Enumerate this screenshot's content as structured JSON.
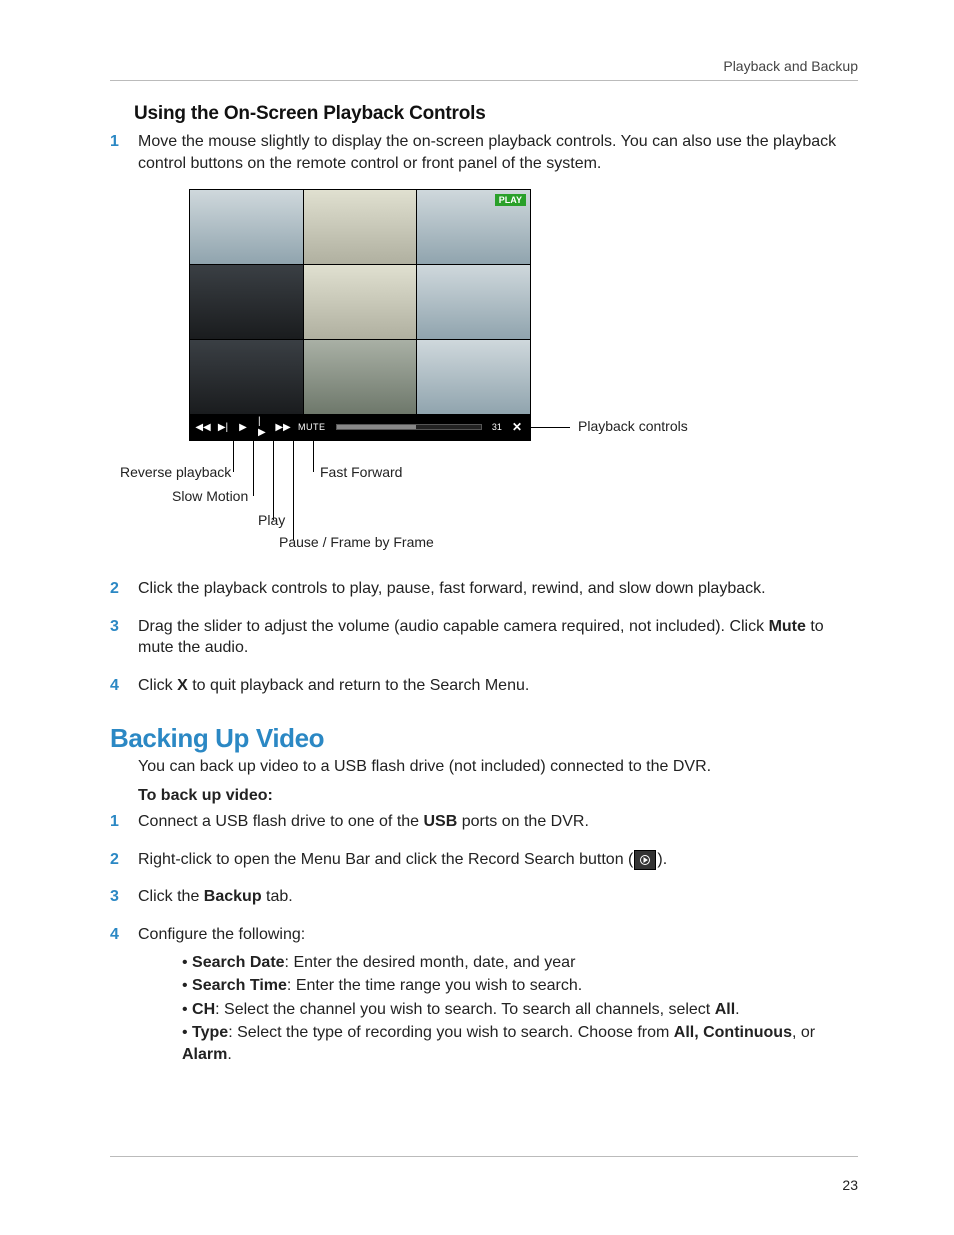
{
  "header": {
    "breadcrumb": "Playback and Backup"
  },
  "section_playback": {
    "heading": "Using the On-Screen Playback Controls",
    "step1": "Move the mouse slightly to display the on-screen playback controls. You can also use the playback control buttons on the remote control or front panel of the system.",
    "step2": "Click the playback controls to play, pause, fast forward, rewind, and slow down playback.",
    "step3_a": "Drag the slider to adjust the volume (audio capable camera required, not included). Click ",
    "step3_b": "Mute",
    "step3_c": " to mute the audio.",
    "step4_a": "Click ",
    "step4_b": "X",
    "step4_c": " to quit playback and return to the Search Menu."
  },
  "figure": {
    "play_badge": "PLAY",
    "mute_label": "MUTE",
    "volume_value": "31",
    "close_symbol": "✕",
    "callouts": {
      "playback_controls": "Playback controls",
      "reverse": "Reverse playback",
      "slow": "Slow Motion",
      "play": "Play",
      "pause": "Pause / Frame by Frame",
      "ff": "Fast Forward"
    }
  },
  "section_backup": {
    "heading": "Backing Up Video",
    "intro": "You can back up video to a USB flash drive (not included) connected to the DVR.",
    "leadin": "To back up video:",
    "step1_a": "Connect a USB flash drive to one of the ",
    "step1_b": "USB",
    "step1_c": " ports on the DVR.",
    "step2_a": "Right-click to open the Menu Bar and click the Record Search button (",
    "step2_b": ").",
    "step3_a": "Click the ",
    "step3_b": "Backup",
    "step3_c": " tab.",
    "step4": "Configure the following:",
    "bullets": {
      "b1_label": "Search Date",
      "b1_text": ": Enter the desired month, date, and year",
      "b2_label": "Search Time",
      "b2_text": ": Enter the time range you wish to search.",
      "b3_label": "CH",
      "b3_text_a": ": Select the channel you wish to search. To search all channels, select ",
      "b3_text_b": "All",
      "b3_text_c": ".",
      "b4_label": "Type",
      "b4_text_a": ": Select the type of recording you wish to search. Choose from ",
      "b4_text_b": "All, Continuous",
      "b4_text_c": ", or ",
      "b4_text_d": "Alarm",
      "b4_text_e": "."
    }
  },
  "page_number": "23"
}
